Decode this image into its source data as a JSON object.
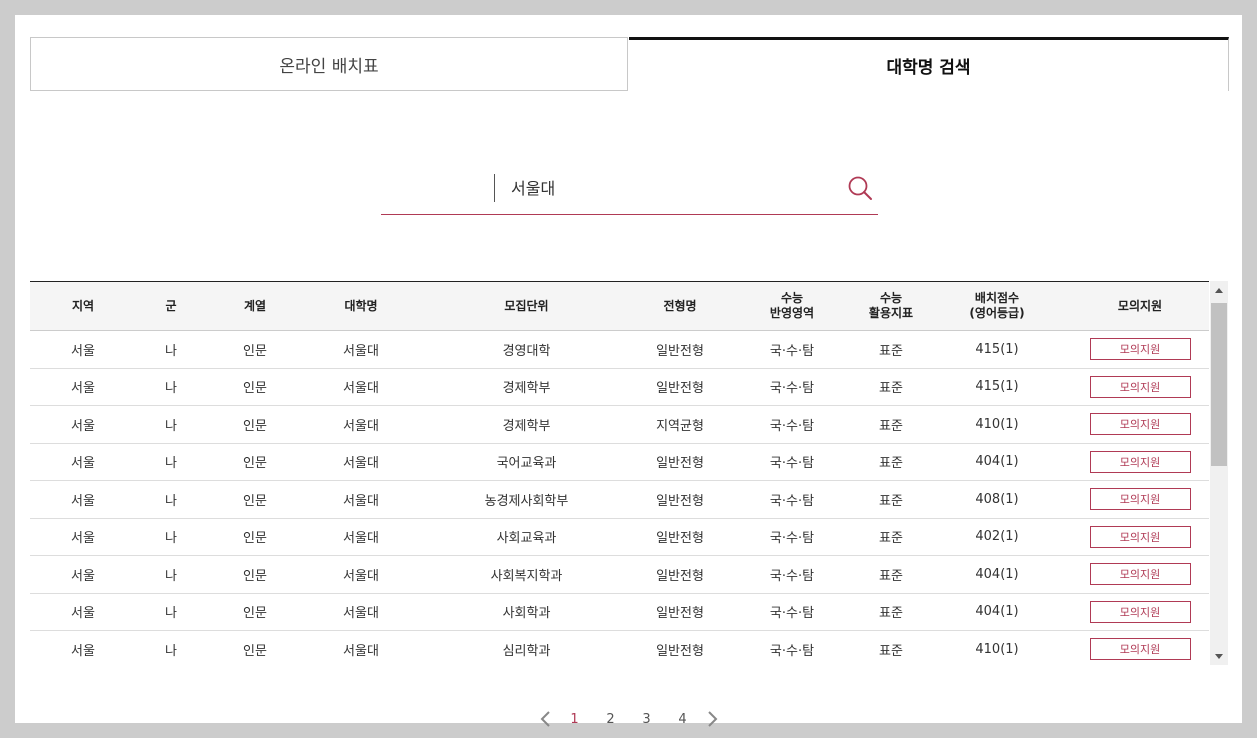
{
  "tabs": [
    {
      "label": "온라인 배치표",
      "active": false
    },
    {
      "label": "대학명 검색",
      "active": true
    }
  ],
  "search": {
    "value": "서울대",
    "icon": "search-icon"
  },
  "table": {
    "headers": [
      {
        "line1": "지역",
        "line2": ""
      },
      {
        "line1": "군",
        "line2": ""
      },
      {
        "line1": "계열",
        "line2": ""
      },
      {
        "line1": "대학명",
        "line2": ""
      },
      {
        "line1": "모집단위",
        "line2": ""
      },
      {
        "line1": "전형명",
        "line2": ""
      },
      {
        "line1": "수능",
        "line2": "반영영역"
      },
      {
        "line1": "수능",
        "line2": "활용지표"
      },
      {
        "line1": "배치점수",
        "line2": "(영어등급)"
      },
      {
        "line1": "모의지원",
        "line2": ""
      }
    ],
    "rows": [
      {
        "region": "서울",
        "group": "나",
        "field": "인문",
        "univ": "서울대",
        "unit": "경영대학",
        "type": "일반전형",
        "areas": "국·수·탐",
        "index": "표준",
        "score": "415(1)",
        "button": "모의지원"
      },
      {
        "region": "서울",
        "group": "나",
        "field": "인문",
        "univ": "서울대",
        "unit": "경제학부",
        "type": "일반전형",
        "areas": "국·수·탐",
        "index": "표준",
        "score": "415(1)",
        "button": "모의지원"
      },
      {
        "region": "서울",
        "group": "나",
        "field": "인문",
        "univ": "서울대",
        "unit": "경제학부",
        "type": "지역균형",
        "areas": "국·수·탐",
        "index": "표준",
        "score": "410(1)",
        "button": "모의지원"
      },
      {
        "region": "서울",
        "group": "나",
        "field": "인문",
        "univ": "서울대",
        "unit": "국어교육과",
        "type": "일반전형",
        "areas": "국·수·탐",
        "index": "표준",
        "score": "404(1)",
        "button": "모의지원"
      },
      {
        "region": "서울",
        "group": "나",
        "field": "인문",
        "univ": "서울대",
        "unit": "농경제사회학부",
        "type": "일반전형",
        "areas": "국·수·탐",
        "index": "표준",
        "score": "408(1)",
        "button": "모의지원"
      },
      {
        "region": "서울",
        "group": "나",
        "field": "인문",
        "univ": "서울대",
        "unit": "사회교육과",
        "type": "일반전형",
        "areas": "국·수·탐",
        "index": "표준",
        "score": "402(1)",
        "button": "모의지원"
      },
      {
        "region": "서울",
        "group": "나",
        "field": "인문",
        "univ": "서울대",
        "unit": "사회복지학과",
        "type": "일반전형",
        "areas": "국·수·탐",
        "index": "표준",
        "score": "404(1)",
        "button": "모의지원"
      },
      {
        "region": "서울",
        "group": "나",
        "field": "인문",
        "univ": "서울대",
        "unit": "사회학과",
        "type": "일반전형",
        "areas": "국·수·탐",
        "index": "표준",
        "score": "404(1)",
        "button": "모의지원"
      },
      {
        "region": "서울",
        "group": "나",
        "field": "인문",
        "univ": "서울대",
        "unit": "심리학과",
        "type": "일반전형",
        "areas": "국·수·탐",
        "index": "표준",
        "score": "410(1)",
        "button": "모의지원"
      }
    ]
  },
  "pagination": {
    "pages": [
      "1",
      "2",
      "3",
      "4"
    ],
    "current": "1",
    "prev_icon": "chevron-left-icon",
    "next_icon": "chevron-right-icon"
  },
  "colors": {
    "accent": "#b03a55",
    "active_tab_border": "#111111"
  }
}
